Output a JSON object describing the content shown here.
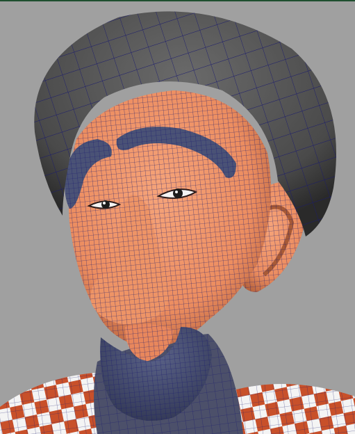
{
  "viewport": {
    "background": "#a0a0a0",
    "border_color": "#1f4f2f",
    "wireframe_color": "#1a1a6e"
  },
  "model": {
    "skin_color": "#f0966a",
    "hat_color": "#505050",
    "eyebrow_color": "#4a5276",
    "beard_color": "#4a5276",
    "shirt_colors": [
      "#c8502a",
      "#f4f4f4"
    ]
  }
}
